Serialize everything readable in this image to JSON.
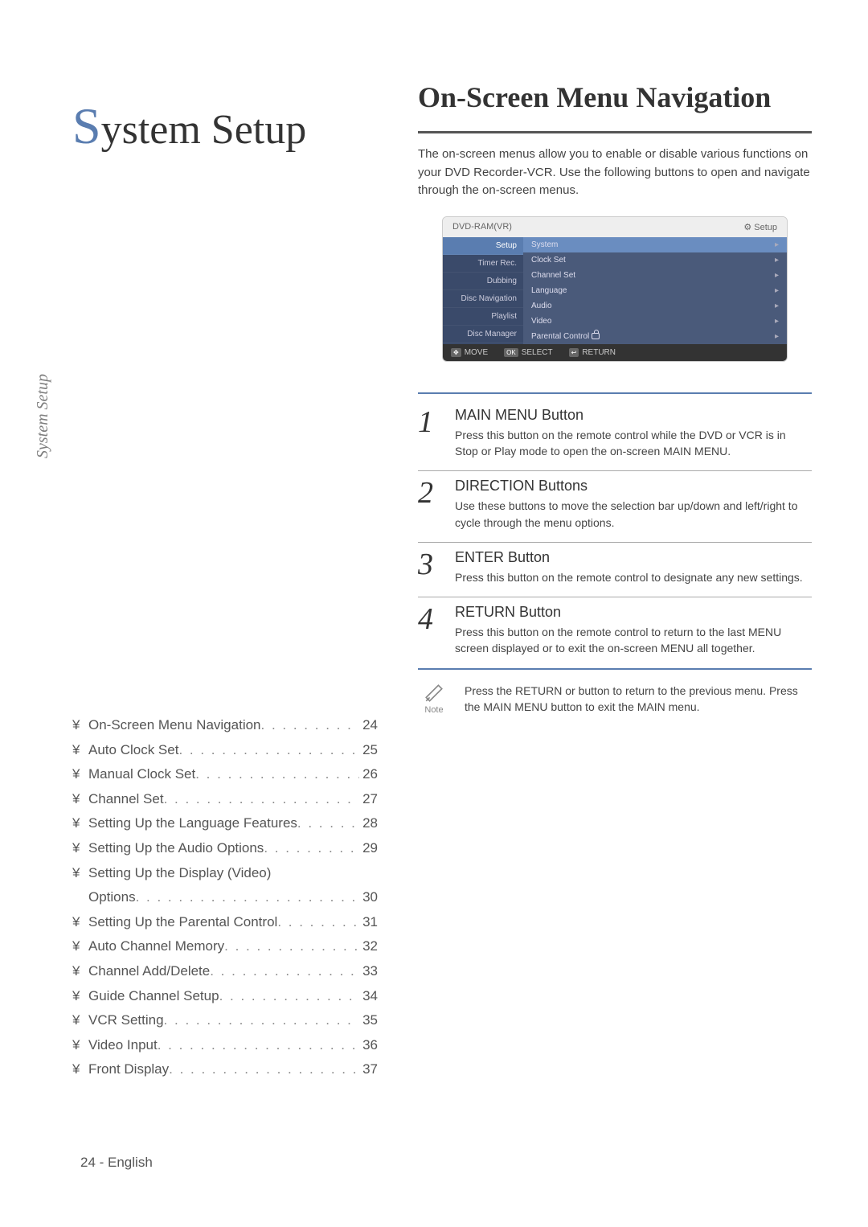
{
  "side_label": "System Setup",
  "chapter_title_first": "S",
  "chapter_title_rest": "ystem Setup",
  "toc": [
    {
      "label": "On-Screen Menu Navigation",
      "page": "24"
    },
    {
      "label": "Auto Clock Set",
      "page": "25"
    },
    {
      "label": "Manual Clock Set",
      "page": "26"
    },
    {
      "label": "Channel Set",
      "page": "27"
    },
    {
      "label": "Setting Up the Language Features",
      "page": "28"
    },
    {
      "label": "Setting Up the Audio Options",
      "page": "29"
    },
    {
      "label": "Setting Up the Display (Video) Options",
      "page": "30",
      "wrap": true
    },
    {
      "label": "Setting Up the Parental Control",
      "page": "31"
    },
    {
      "label": "Auto Channel Memory",
      "page": "32"
    },
    {
      "label": "Channel Add/Delete",
      "page": "33"
    },
    {
      "label": "Guide Channel Setup",
      "page": "34"
    },
    {
      "label": "VCR Setting",
      "page": "35"
    },
    {
      "label": "Video Input",
      "page": "36"
    },
    {
      "label": "Front Display",
      "page": "37"
    }
  ],
  "bullet": "¥",
  "section_title": "On-Screen Menu Navigation",
  "intro": "The on-screen menus allow you to enable or disable various functions on your DVD Recorder-VCR. Use the following buttons to open and navigate through the on-screen menus.",
  "menu": {
    "top_left": "DVD-RAM(VR)",
    "top_right_label": "Setup",
    "side_items": [
      "Setup",
      "Timer Rec.",
      "Dubbing",
      "Disc Navigation",
      "Playlist",
      "Disc Manager"
    ],
    "main_items": [
      "System",
      "Clock Set",
      "Channel Set",
      "Language",
      "Audio",
      "Video",
      "Parental Control"
    ],
    "foot": {
      "move": "MOVE",
      "select": "SELECT",
      "return": "RETURN"
    }
  },
  "steps": [
    {
      "num": "1",
      "title": "MAIN MENU Button",
      "desc": "Press this button on the remote control while the DVD or VCR is in Stop or Play mode to open the on-screen MAIN MENU."
    },
    {
      "num": "2",
      "title": "DIRECTION Buttons",
      "desc": "Use these buttons to move the selection bar up/down and left/right to cycle through the menu options."
    },
    {
      "num": "3",
      "title": "ENTER Button",
      "desc": "Press this button on the remote control to designate any new settings."
    },
    {
      "num": "4",
      "title": "RETURN Button",
      "desc": "Press this button on the remote control to return to the last MENU screen displayed or to exit the on-screen MENU all together."
    }
  ],
  "note_label": "Note",
  "note_text": "Press the RETURN or     button to return to the previous menu. Press the MAIN MENU button to exit the MAIN menu.",
  "footer": "24 - English"
}
